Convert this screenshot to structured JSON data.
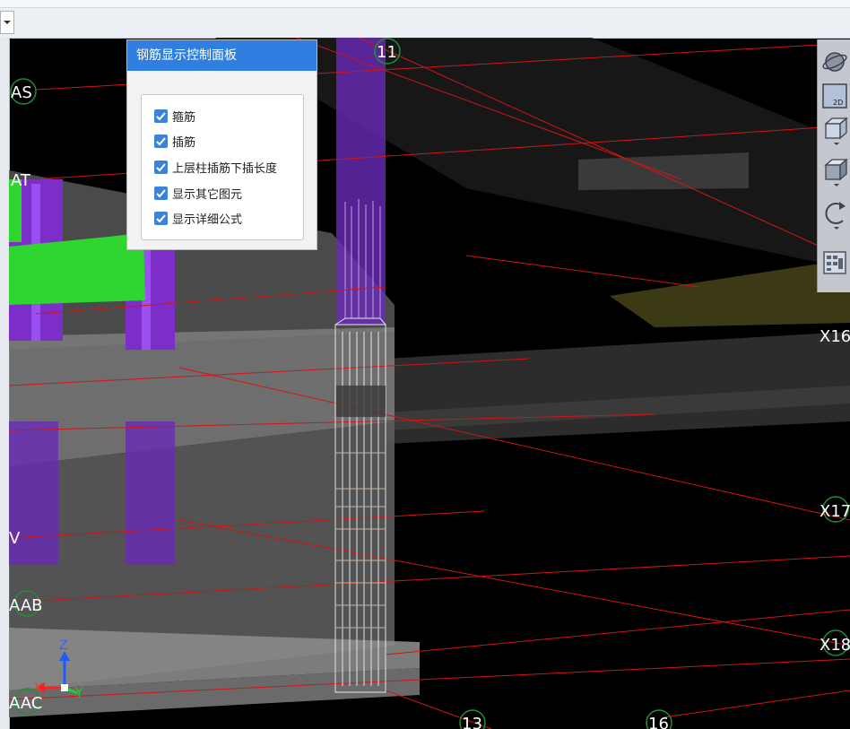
{
  "panel": {
    "title": "钢筋显示控制面板",
    "options": [
      {
        "label": "箍筋",
        "checked": true
      },
      {
        "label": "插筋",
        "checked": true
      },
      {
        "label": "上层柱插筋下插长度",
        "checked": true
      },
      {
        "label": "显示其它图元",
        "checked": true
      },
      {
        "label": "显示详细公式",
        "checked": true
      }
    ]
  },
  "axis_labels": {
    "as": "AS",
    "at": "AT",
    "aab": "AAB",
    "aac": "AAC",
    "v": "V",
    "n11": "11",
    "n13": "13",
    "n16": "16",
    "x16": "X16",
    "x17": "X17",
    "x18": "X18"
  },
  "gizmo": {
    "z": "Z",
    "x": "X",
    "y": "Y"
  },
  "toolbar": {
    "icons": [
      "orbit-icon",
      "2d-view-icon",
      "view-cube-icon",
      "shaded-box-icon",
      "rotate-icon",
      "checklist-icon"
    ],
    "label_2d": "2D"
  },
  "colors": {
    "panel_title_bg": "#2f7fe1",
    "checkbox": "#3c82d8",
    "axis_line": "#d01515",
    "column_purple": "#7b2fc8",
    "beam_green": "#2fd62f",
    "background": "#000000"
  }
}
